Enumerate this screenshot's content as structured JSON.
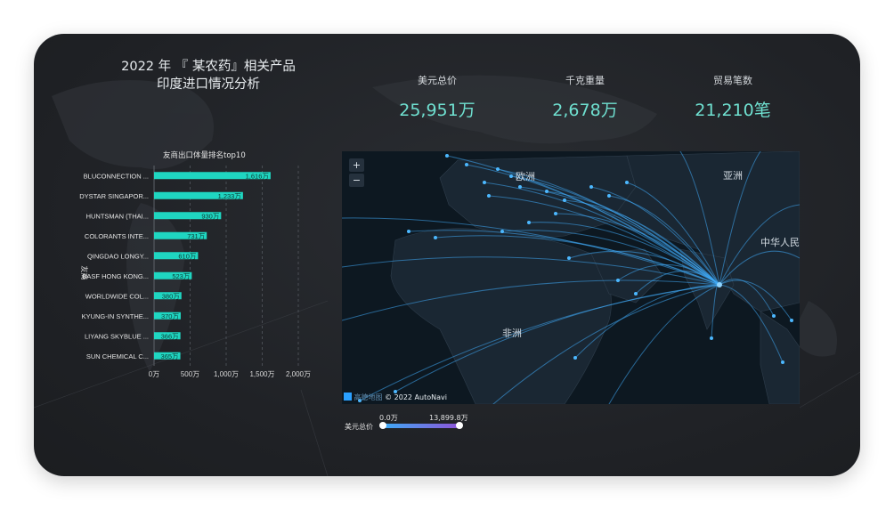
{
  "title": {
    "line1": "2022 年 『 某农药』相关产品",
    "line2": "印度进口情况分析"
  },
  "kpis": [
    {
      "label": "美元总价",
      "value": "25,951万"
    },
    {
      "label": "千克重量",
      "value": "2,678万"
    },
    {
      "label": "贸易笔数",
      "value": "21,210笔"
    }
  ],
  "chart_data": {
    "type": "bar",
    "title": "友商出口体量排名top10",
    "ylabel": "友商",
    "categories": [
      "BLUCONNECTION ...",
      "DYSTAR SINGAPOR...",
      "HUNTSMAN (THAI...",
      "COLORANTS INTE...",
      "QINGDAO LONGY...",
      "BASF HONG KONG...",
      "WORLDWIDE COL...",
      "KYUNG-IN SYNTHE...",
      "LIYANG SKYBLUE ...",
      "SUN CHEMICAL C..."
    ],
    "values": [
      1616,
      1233,
      930,
      731,
      610,
      523,
      380,
      370,
      366,
      365
    ],
    "value_labels": [
      "1,616万",
      "1,233万",
      "930万",
      "731万",
      "610万",
      "523万",
      "380万",
      "370万",
      "366万",
      "365万"
    ],
    "xticks": [
      0,
      500,
      1000,
      1500,
      2000
    ],
    "xtick_labels": [
      "0万",
      "500万",
      "1,000万",
      "1,500万",
      "2,000万"
    ],
    "xlim": [
      0,
      2000
    ],
    "grid": true,
    "bar_color": "#1fd6c1"
  },
  "map": {
    "labels": {
      "europe": "欧洲",
      "asia": "亚洲",
      "china": "中华人民",
      "africa": "非洲"
    },
    "zoom_in": "+",
    "zoom_out": "−",
    "attribution": "© 2022 AutoNavi",
    "logo_text": "高德地图"
  },
  "legend": {
    "label": "美元总价",
    "min": "0.0万",
    "max": "13,899.8万"
  },
  "colors": {
    "accent": "#6fe0d0",
    "bar": "#1fd6c1",
    "arc": "#3fa9f5",
    "legend_start": "#3fa9f5",
    "legend_end": "#8e54d8"
  }
}
